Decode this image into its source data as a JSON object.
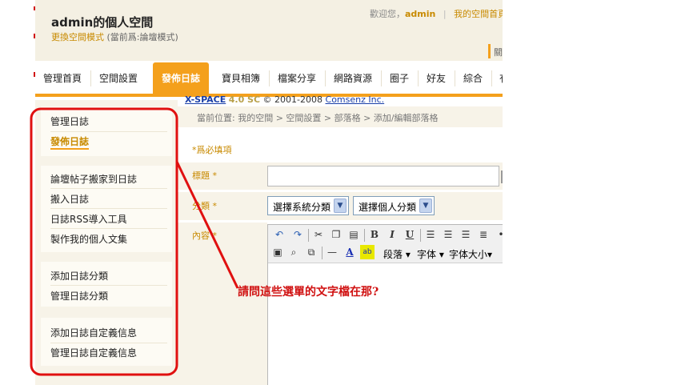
{
  "header": {
    "site_title": "admin的個人空間",
    "mode_link": "更換空間模式",
    "mode_current": "(當前爲:論壇模式)",
    "welcome_prefix": "歡迎您，",
    "welcome_user": "admin",
    "divider": "|",
    "my_space_home": "我的空間首頁",
    "clipped_text": "關"
  },
  "nav": {
    "tabs": [
      {
        "label": "管理首頁"
      },
      {
        "label": "空間設置"
      },
      {
        "label": "發佈日誌"
      },
      {
        "label": "寶貝相簿"
      },
      {
        "label": "檔案分享"
      },
      {
        "label": "網路資源"
      },
      {
        "label": "圈子"
      },
      {
        "label": "好友"
      },
      {
        "label": "綜合"
      },
      {
        "label": "有"
      }
    ]
  },
  "copyright": {
    "product": "X-SPACE",
    "version": "4.0 SC",
    "years": "© 2001-2008",
    "company": "Comsenz Inc."
  },
  "sidebar": {
    "group1": [
      "管理日誌",
      "發佈日誌"
    ],
    "group2": [
      "論壇帖子搬家到日誌",
      "搬入日誌",
      "日誌RSS導入工具",
      "製作我的個人文集"
    ],
    "group3": [
      "添加日誌分類",
      "管理日誌分類"
    ],
    "group4": [
      "添加日誌自定義信息",
      "管理日誌自定義信息"
    ]
  },
  "content": {
    "breadcrumb": "當前位置: 我的空間 > 空間設置 > 部落格 > 添加/編輯部落格",
    "required_note": "*爲必填項",
    "title_label": "標題 *",
    "title_value": "",
    "category_label": "分類 *",
    "system_category": "選擇系統分類",
    "personal_category": "選擇個人分類",
    "content_label": "內容 *"
  },
  "editor": {
    "bold": "B",
    "italic": "I",
    "underline": "U",
    "paragraph": "段落",
    "font": "字体",
    "font_size": "字体大小",
    "font_color_glyph": "A",
    "highlight_glyph": "ab"
  },
  "annotation": {
    "text": "請問這些選單的文字檔在那?",
    "color": "#d01010"
  },
  "colors": {
    "accent": "#f4a01c",
    "link": "#c88a00",
    "annotation": "#d01010"
  }
}
